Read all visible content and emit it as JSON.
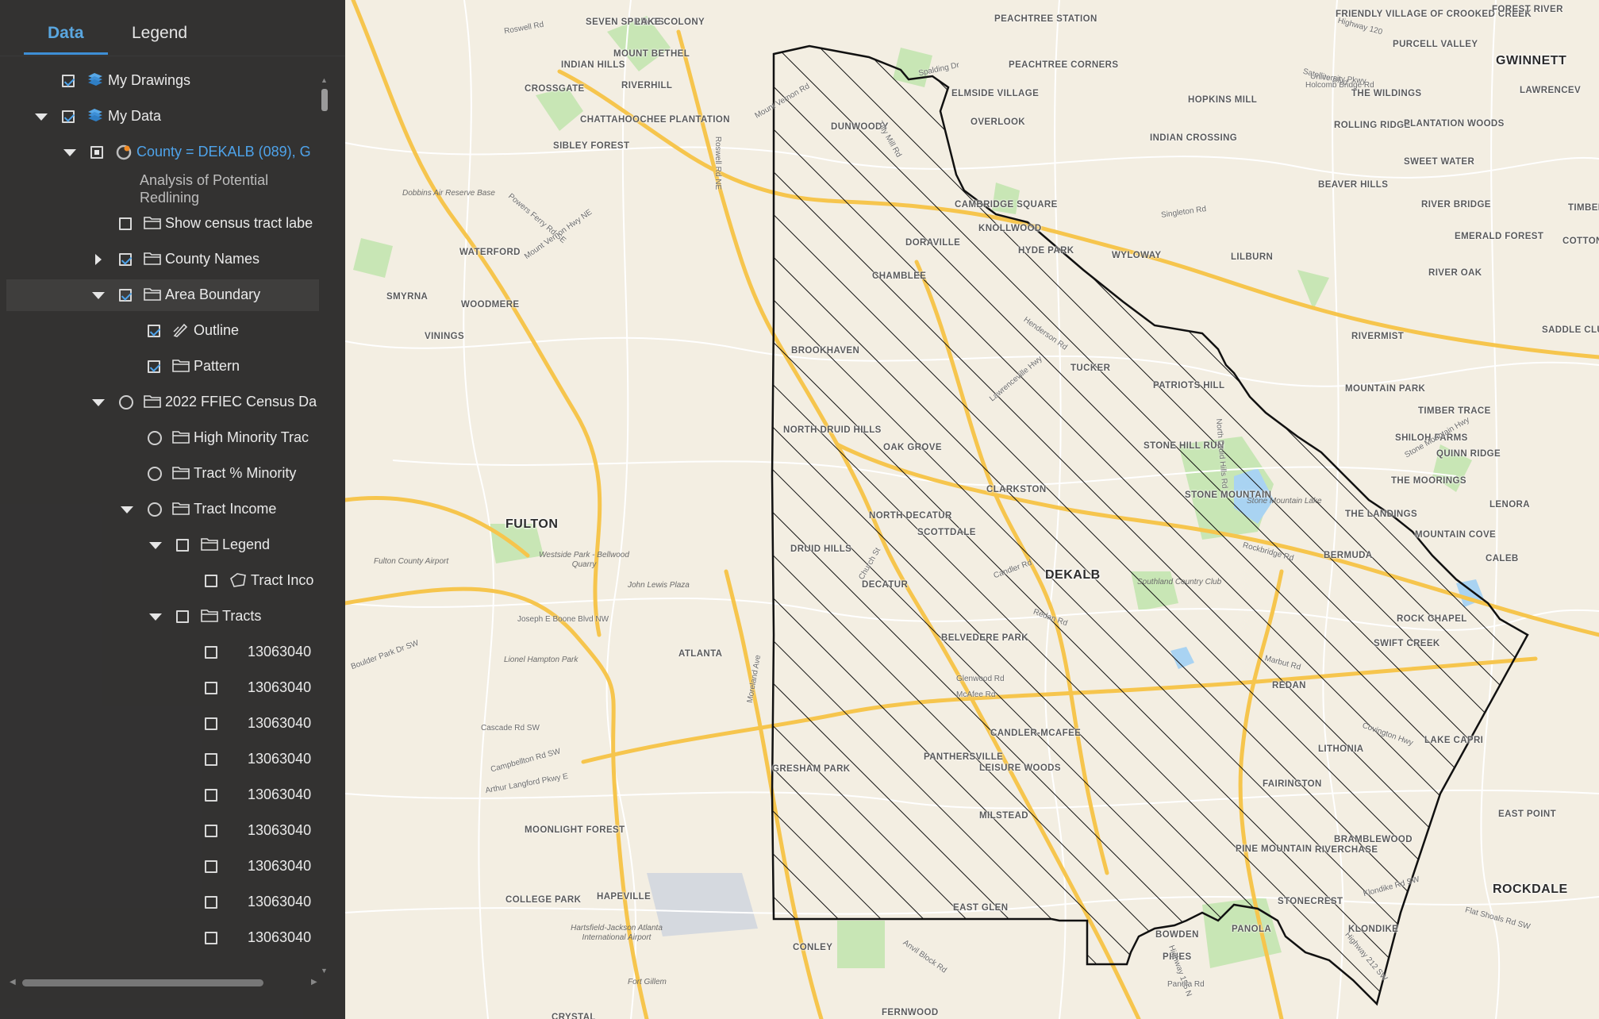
{
  "panel": {
    "tabs": [
      {
        "label": "Data",
        "active": true
      },
      {
        "label": "Legend",
        "active": false
      }
    ],
    "rows": [
      {
        "name": "my-drawings",
        "label": "My Drawings",
        "indent": 0,
        "expand": "none",
        "control": "checked",
        "icon": "layer-stack-icon"
      },
      {
        "name": "my-data",
        "label": "My Data",
        "indent": 0,
        "expand": "down",
        "control": "checked",
        "icon": "layer-stack-icon"
      },
      {
        "name": "county-dekalb",
        "label": "County = DEKALB (089), G",
        "indent": 1,
        "expand": "down",
        "control": "partial",
        "icon": "sync-service-icon",
        "link": true
      },
      {
        "name": "description",
        "label": "Analysis of Potential\nRedlining",
        "indent": 1,
        "expand": "none",
        "control": "none",
        "icon": "none",
        "isDesc": true
      },
      {
        "name": "show-census-tract-labels",
        "label": "Show census tract labe",
        "indent": 2,
        "expand": "none",
        "control": "unchecked",
        "icon": "folder-icon"
      },
      {
        "name": "county-names",
        "label": "County Names",
        "indent": 2,
        "expand": "right",
        "control": "checked",
        "icon": "folder-icon"
      },
      {
        "name": "area-boundary",
        "label": "Area Boundary",
        "indent": 2,
        "expand": "down",
        "control": "checked",
        "icon": "folder-icon",
        "highlight": true
      },
      {
        "name": "outline",
        "label": "Outline",
        "indent": 3,
        "expand": "none",
        "control": "checked",
        "icon": "pen-style-icon"
      },
      {
        "name": "pattern",
        "label": "Pattern",
        "indent": 3,
        "expand": "none",
        "control": "checked",
        "icon": "folder-icon"
      },
      {
        "name": "ffiec-census-data",
        "label": "2022 FFIEC Census Da",
        "indent": 2,
        "expand": "down",
        "control": "radio",
        "icon": "folder-icon"
      },
      {
        "name": "high-minority-tracts",
        "label": "High Minority Trac",
        "indent": 3,
        "expand": "none",
        "control": "radio",
        "icon": "folder-icon"
      },
      {
        "name": "tract-minority",
        "label": "Tract % Minority",
        "indent": 3,
        "expand": "none",
        "control": "radio",
        "icon": "folder-icon"
      },
      {
        "name": "tract-income",
        "label": "Tract Income",
        "indent": 3,
        "expand": "down",
        "control": "radio",
        "icon": "folder-icon"
      },
      {
        "name": "legend-group",
        "label": "Legend",
        "indent": 4,
        "expand": "down",
        "control": "unchecked",
        "icon": "folder-icon"
      },
      {
        "name": "tract-income-legend",
        "label": "Tract Inco",
        "indent": 5,
        "expand": "none",
        "control": "unchecked",
        "icon": "polygon-icon"
      },
      {
        "name": "tracts-group",
        "label": "Tracts",
        "indent": 4,
        "expand": "down",
        "control": "unchecked",
        "icon": "folder-icon"
      },
      {
        "name": "tract-row",
        "label": "13063040",
        "indent": 5,
        "expand": "none",
        "control": "unchecked",
        "icon": "none"
      },
      {
        "name": "tract-row",
        "label": "13063040",
        "indent": 5,
        "expand": "none",
        "control": "unchecked",
        "icon": "none"
      },
      {
        "name": "tract-row",
        "label": "13063040",
        "indent": 5,
        "expand": "none",
        "control": "unchecked",
        "icon": "none"
      },
      {
        "name": "tract-row",
        "label": "13063040",
        "indent": 5,
        "expand": "none",
        "control": "unchecked",
        "icon": "none"
      },
      {
        "name": "tract-row",
        "label": "13063040",
        "indent": 5,
        "expand": "none",
        "control": "unchecked",
        "icon": "none"
      },
      {
        "name": "tract-row",
        "label": "13063040",
        "indent": 5,
        "expand": "none",
        "control": "unchecked",
        "icon": "none"
      },
      {
        "name": "tract-row",
        "label": "13063040",
        "indent": 5,
        "expand": "none",
        "control": "unchecked",
        "icon": "none"
      },
      {
        "name": "tract-row",
        "label": "13063040",
        "indent": 5,
        "expand": "none",
        "control": "unchecked",
        "icon": "none"
      },
      {
        "name": "tract-row",
        "label": "13063040",
        "indent": 5,
        "expand": "none",
        "control": "unchecked",
        "icon": "none"
      }
    ]
  },
  "map": {
    "counties": [
      "GWINNETT",
      "FULTON",
      "DEKALB",
      "ROCKDALE"
    ],
    "places": [
      "SEVEN SPRINGS",
      "LAKE COLONY",
      "PEACHTREE STATION",
      "FRIENDLY VILLAGE OF CROOKED CREEK",
      "PURCELL VALLEY",
      "FOREST RIVER",
      "INDIAN HILLS",
      "MOUNT BETHEL",
      "RIVERHILL",
      "CROSSGATE",
      "ELMSIDE VILLAGE",
      "PEACHTREE CORNERS",
      "DUNWOODY",
      "OVERLOOK",
      "HOPKINS MILL",
      "THE WILDINGS",
      "LAWRENCEV",
      "CHATTAHOOCHEE PLANTATION",
      "SIBLEY FOREST",
      "INDIAN CROSSING",
      "ROLLING RIDGE",
      "PLANTATION WOODS",
      "CAMBRIDGE SQUARE",
      "KNOLLWOOD",
      "SWEET WATER",
      "BEAVER HILLS",
      "DORAVILLE",
      "HYDE PARK",
      "WYLOWAY",
      "LILBURN",
      "RIVER BRIDGE",
      "EMERALD FOREST",
      "COTTON CREEK",
      "TIMBER",
      "WATERFORD",
      "CHAMBLEE",
      "RIVER OAK",
      "SMYRNA",
      "WOODMERE",
      "SADDLE CLUB ESTATES",
      "VININGS",
      "BROOKHAVEN",
      "TUCKER",
      "RIVERMIST",
      "PATRIOTS HILL",
      "MOUNTAIN PARK",
      "TIMBER TRACE",
      "NORTH DRUID HILLS",
      "OAK GROVE",
      "STONE HILL RUN",
      "SHILOH FARMS",
      "QUINN RIDGE",
      "CLARKSTON",
      "STONE MOUNTAIN",
      "THE MOORINGS",
      "LENORA",
      "NORTH DECATUR",
      "SCOTTDALE",
      "THE LANDINGS",
      "MOUNTAIN COVE",
      "DRUID HILLS",
      "BERMUDA",
      "CALEB",
      "DECATUR",
      "ROCK CHAPEL",
      "ATLANTA",
      "BELVEDERE PARK",
      "SWIFT CREEK",
      "REDAN",
      "CANDLER-MCAFEE",
      "PANTHERSVILLE",
      "LITHONIA",
      "LAKE CAPRI",
      "GRESHAM PARK",
      "LEISURE WOODS",
      "FAIRINGTON",
      "EAST POINT",
      "MOONLIGHT FOREST",
      "MILSTEAD",
      "RIVERCHASE",
      "BRAMBLEWOOD",
      "PINE MOUNTAIN",
      "COLLEGE PARK",
      "HAPEVILLE",
      "EAST GLEN",
      "STONECREST",
      "BOWDEN",
      "PANOLA",
      "KLONDIKE",
      "CONLEY",
      "PINES",
      "CRYSTAL",
      "FERNWOOD"
    ],
    "roads": [
      "Roswell Rd",
      "Holcomb Bridge Rd",
      "Spalding Dr",
      "Satellite Blvd",
      "University Pkwy",
      "Highway 120",
      "Mount Vernon Rd",
      "Tilly Mill Rd",
      "Powers Ferry Rd SE",
      "Mount Vernon Hwy NE",
      "Roswell Rd NE",
      "Singleton Rd",
      "Henderson Rd",
      "Lawrenceville Hwy",
      "Stone Mountain Hwy",
      "Rockbridge Rd",
      "Redan Rd",
      "Glenwood Rd",
      "Covington Hwy",
      "Marbut Rd",
      "Moreland Ave",
      "Joseph E Boone Blvd NW",
      "Boulder Park Dr SW",
      "Cascade Rd SW",
      "Campbellton Rd SW",
      "Arthur Langford Pkwy E",
      "Anvil Block Rd",
      "Klondike Rd SW",
      "Flat Shoals Rd SW",
      "Highway 212 SW",
      "Highway 155 N",
      "Panola Rd",
      "North Druid Hills Rd",
      "McAfee Rd",
      "Church St",
      "Candler Rd"
    ],
    "pois": [
      "Dobbins Air Reserve Base",
      "Westside Park - Bellwood Quarry",
      "Lionel Hampton Park",
      "Hartsfield-Jackson Atlanta International Airport",
      "Fort Gillem",
      "Southland Country Club",
      "Stone Mountain Lake",
      "John Lewis Plaza",
      "Fulton County Airport"
    ]
  }
}
